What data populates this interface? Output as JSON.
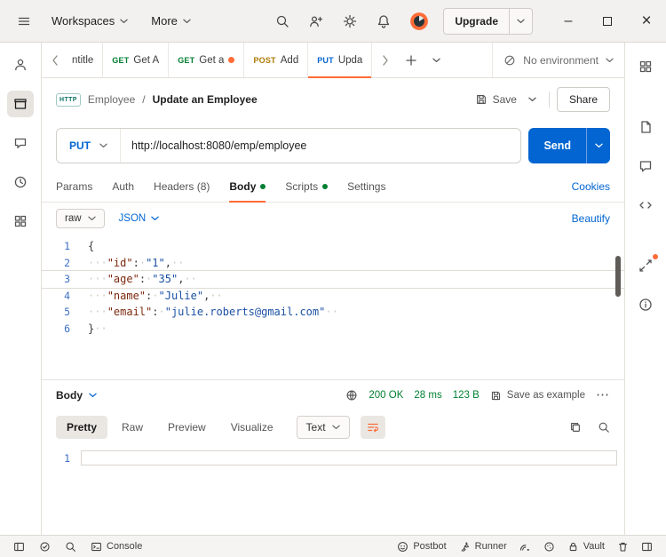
{
  "colors": {
    "accent_orange": "#ff6c37",
    "primary_blue": "#0265d2",
    "success_green": "#007f31",
    "method_get": "#007f31",
    "method_post": "#ad7a03",
    "method_put": "#0265d2"
  },
  "topbar": {
    "workspaces_label": "Workspaces",
    "more_label": "More",
    "upgrade_label": "Upgrade"
  },
  "tabbar": {
    "tabs": [
      {
        "method": "",
        "label": "ntitle"
      },
      {
        "method": "GET",
        "label": "Get A"
      },
      {
        "method": "GET",
        "label": "Get a"
      },
      {
        "method": "POST",
        "label": "Add"
      },
      {
        "method": "PUT",
        "label": "Upda"
      }
    ],
    "environment_label": "No environment"
  },
  "request": {
    "collection": "Employee",
    "separator": "/",
    "name": "Update an Employee",
    "save_label": "Save",
    "share_label": "Share",
    "method": "PUT",
    "url": "http://localhost:8080/emp/employee",
    "send_label": "Send",
    "tabs": [
      "Params",
      "Auth",
      "Headers (8)",
      "Body",
      "Scripts",
      "Settings"
    ],
    "cookies_label": "Cookies",
    "body_type": "raw",
    "body_format": "JSON",
    "beautify_label": "Beautify"
  },
  "editor": {
    "active_line": 3,
    "lines": [
      [
        [
          "{",
          "p"
        ]
      ],
      [
        [
          "···",
          "w"
        ],
        [
          "\"id\"",
          "k"
        ],
        [
          ":",
          "p"
        ],
        [
          "·",
          "w"
        ],
        [
          "\"1\"",
          "s"
        ],
        [
          ",",
          "p"
        ],
        [
          "··",
          "w"
        ]
      ],
      [
        [
          "···",
          "w"
        ],
        [
          "\"age\"",
          "k"
        ],
        [
          ":",
          "p"
        ],
        [
          "·",
          "w"
        ],
        [
          "\"35\"",
          "s"
        ],
        [
          ",",
          "p"
        ],
        [
          "··",
          "w"
        ]
      ],
      [
        [
          "···",
          "w"
        ],
        [
          "\"name\"",
          "k"
        ],
        [
          ":",
          "p"
        ],
        [
          "·",
          "w"
        ],
        [
          "\"Julie\"",
          "s"
        ],
        [
          ",",
          "p"
        ],
        [
          "··",
          "w"
        ]
      ],
      [
        [
          "···",
          "w"
        ],
        [
          "\"email\"",
          "k"
        ],
        [
          ":",
          "p"
        ],
        [
          "·",
          "w"
        ],
        [
          "\"julie.roberts@gmail.com\"",
          "s"
        ],
        [
          "··",
          "w"
        ]
      ],
      [
        [
          "}",
          "p"
        ],
        [
          "··",
          "w"
        ]
      ]
    ]
  },
  "response": {
    "body_label": "Body",
    "status": "200 OK",
    "time": "28 ms",
    "size": "123 B",
    "save_as_example_label": "Save as example",
    "views": [
      "Pretty",
      "Raw",
      "Preview",
      "Visualize"
    ],
    "active_view": "Pretty",
    "format": "Text",
    "empty_line_number": "1"
  },
  "statusbar": {
    "console_label": "Console",
    "postbot_label": "Postbot",
    "runner_label": "Runner",
    "vault_label": "Vault"
  },
  "icons": {
    "http_badge": "HTTP",
    "ellipsis": "⋯",
    "minimize": "–",
    "close": "×"
  }
}
